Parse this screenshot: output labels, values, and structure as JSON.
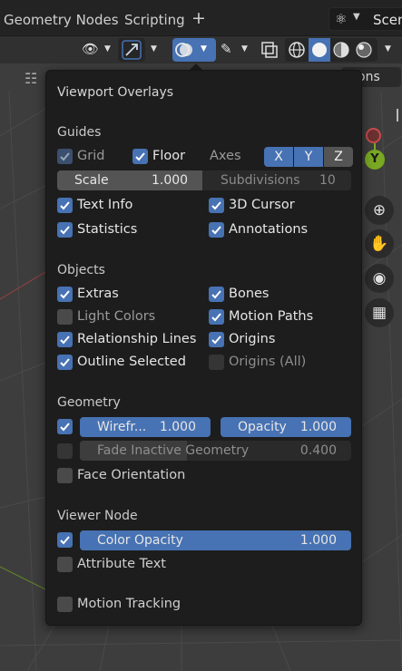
{
  "topbar": {
    "tabs": [
      "Geometry Nodes",
      "Scripting"
    ],
    "add_tab_glyph": "+",
    "scene_label": "Scen"
  },
  "header": {
    "options_label": "ons"
  },
  "overlay": {
    "title": "Viewport Overlays",
    "guides": {
      "section": "Guides",
      "grid": "Grid",
      "floor": "Floor",
      "axes": "Axes",
      "axis_x": "X",
      "axis_y": "Y",
      "axis_z": "Z",
      "scale_label": "Scale",
      "scale_value": "1.000",
      "subdivisions_label": "Subdivisions",
      "subdivisions_value": "10",
      "text_info": "Text Info",
      "cursor_3d": "3D Cursor",
      "statistics": "Statistics",
      "annotations": "Annotations"
    },
    "objects": {
      "section": "Objects",
      "extras": "Extras",
      "bones": "Bones",
      "light_colors": "Light Colors",
      "motion_paths": "Motion Paths",
      "relationship_lines": "Relationship Lines",
      "origins": "Origins",
      "outline_selected": "Outline Selected",
      "origins_all": "Origins (All)"
    },
    "geometry": {
      "section": "Geometry",
      "wireframe_label": "Wirefr...",
      "wireframe_value": "1.000",
      "opacity_label": "Opacity",
      "opacity_value": "1.000",
      "fade_label": "Fade Inactive Geometry",
      "fade_value": "0.400",
      "face_orientation": "Face Orientation"
    },
    "viewer_node": {
      "section": "Viewer Node",
      "color_opacity_label": "Color Opacity",
      "color_opacity_value": "1.000",
      "attribute_text": "Attribute Text"
    },
    "motion_tracking": "Motion Tracking"
  },
  "colors": {
    "accent": "#4772b3",
    "panel_bg": "#1d1d1d",
    "gizmo_y": "#7aa823",
    "gizmo_x": "#c94a4a"
  }
}
